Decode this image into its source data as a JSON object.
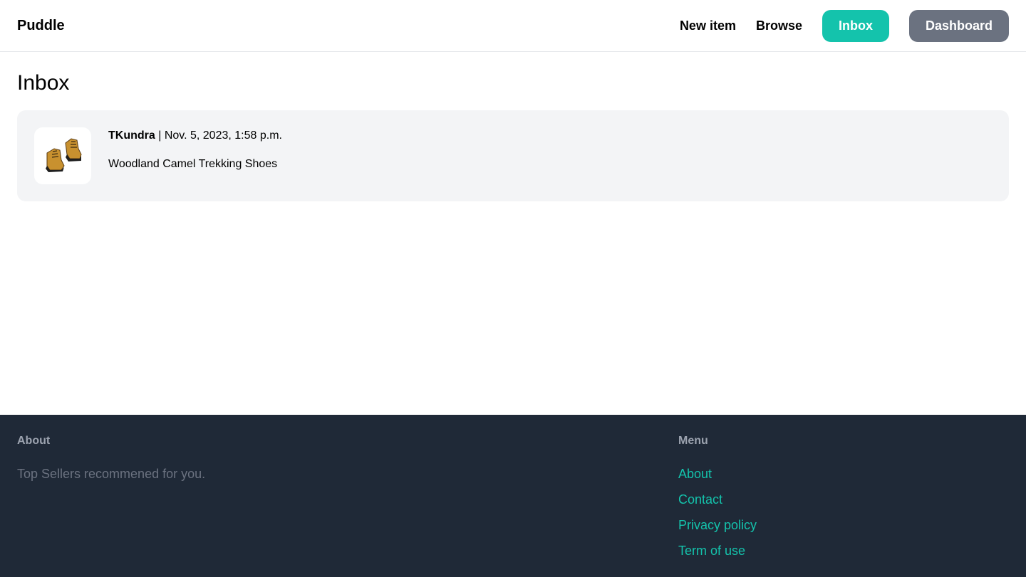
{
  "navbar": {
    "brand": "Puddle",
    "links": {
      "new_item": "New item",
      "browse": "Browse",
      "inbox": "Inbox",
      "dashboard": "Dashboard"
    },
    "colors": {
      "inbox": "#14c3ac",
      "dashboard": "#6b7280"
    }
  },
  "page": {
    "title": "Inbox"
  },
  "conversations": [
    {
      "user": "TKundra",
      "separator": " | ",
      "timestamp": "Nov. 5, 2023, 1:58 p.m.",
      "item": "Woodland Camel Trekking Shoes",
      "thumbnail_icon": "trekking-shoes-image"
    }
  ],
  "footer": {
    "about_heading": "About",
    "about_text": "Top Sellers recommened for you.",
    "menu_heading": "Menu",
    "menu_items": [
      "About",
      "Contact",
      "Privacy policy",
      "Term of use"
    ],
    "background": "#1f2937",
    "link_color": "#14c3ac"
  }
}
